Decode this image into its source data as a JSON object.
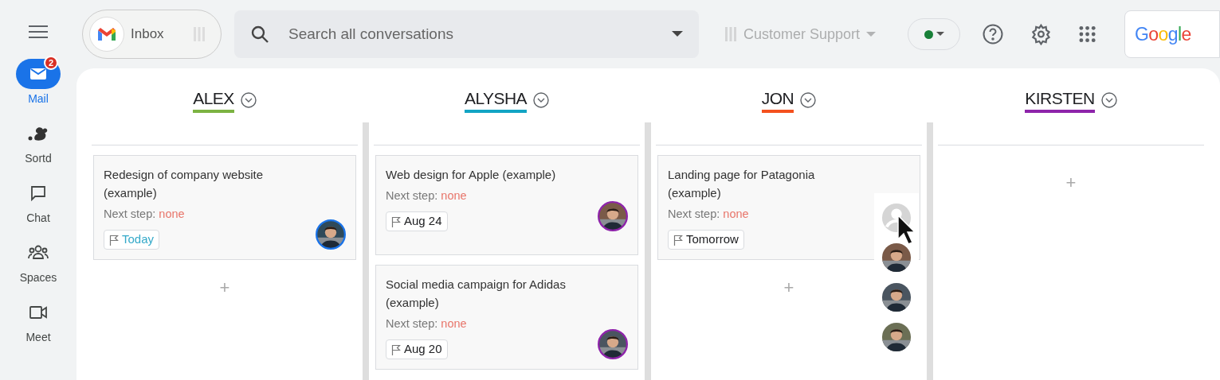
{
  "sidebar": {
    "items": [
      {
        "label": "Mail",
        "kind": "mail",
        "selected": true,
        "badge": "2"
      },
      {
        "label": "Sortd",
        "kind": "sortd",
        "selected": false
      },
      {
        "label": "Chat",
        "kind": "chat",
        "selected": false
      },
      {
        "label": "Spaces",
        "kind": "spaces",
        "selected": false
      },
      {
        "label": "Meet",
        "kind": "meet",
        "selected": false
      }
    ]
  },
  "topbar": {
    "inbox_label": "Inbox",
    "search": {
      "placeholder": "Search all conversations"
    },
    "board_selector": {
      "label": "Customer Support",
      "disabled": true
    },
    "status": {
      "color": "#188038"
    },
    "account_logo": "Google"
  },
  "board": {
    "columns": [
      {
        "name": "ALEX",
        "color": "#7cb342",
        "add_label": "+",
        "cards": [
          {
            "title": "Redesign of company website (example)",
            "next_step_label": "Next step:",
            "next_step": "none",
            "due": {
              "label": "Today",
              "kind": "today"
            }
          }
        ]
      },
      {
        "name": "ALYSHA",
        "color": "#12a4c4",
        "cards": [
          {
            "title": "Web design for Apple (example)",
            "next_step_label": "Next step:",
            "next_step": "none",
            "due": {
              "label": "Aug 24",
              "kind": "date"
            }
          },
          {
            "title": "Social media campaign for Adidas (example)",
            "next_step_label": "Next step:",
            "next_step": "none",
            "due": {
              "label": "Aug 20",
              "kind": "date"
            }
          }
        ]
      },
      {
        "name": "JON",
        "color": "#f4511e",
        "add_label": "+",
        "cards": [
          {
            "title": "Landing page for Patagonia (example)",
            "next_step_label": "Next step:",
            "next_step": "none",
            "due": {
              "label": "Tomorrow",
              "kind": "date"
            },
            "assignee_picker": {
              "open": true
            }
          }
        ]
      },
      {
        "name": "KIRSTEN",
        "color": "#8e24aa",
        "add_label": "+"
      }
    ]
  }
}
